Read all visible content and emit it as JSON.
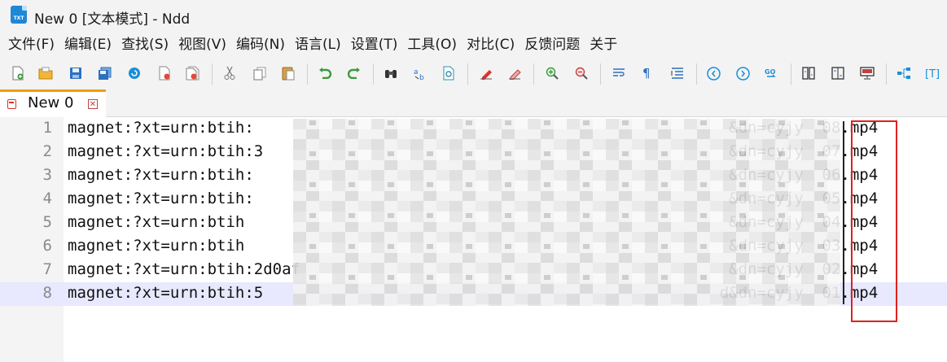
{
  "window": {
    "app_icon_text": "TXT",
    "title": "New 0 [文本模式] - Ndd"
  },
  "menu": [
    "文件(F)",
    "编辑(E)",
    "查找(S)",
    "视图(V)",
    "编码(N)",
    "语言(L)",
    "设置(T)",
    "工具(O)",
    "对比(C)",
    "反馈问题",
    "关于"
  ],
  "toolbar_icons": [
    "new-file-icon",
    "open-file-icon",
    "save-icon",
    "save-all-icon",
    "reload-icon",
    "close-icon",
    "close-all-icon",
    "cut-icon",
    "copy-icon",
    "paste-icon",
    "undo-icon",
    "redo-icon",
    "find-icon",
    "replace-icon",
    "find-in-files-icon",
    "mark-icon",
    "clear-mark-icon",
    "zoom-in-icon",
    "zoom-out-icon",
    "wrap-icon",
    "show-symbols-icon",
    "indent-guide-icon",
    "prev-icon",
    "next-icon",
    "goto-icon",
    "compare-file-icon",
    "compare-dir-icon",
    "compare-bin-icon",
    "structure-icon",
    "text-mode-icon"
  ],
  "tab": {
    "label": "New 0",
    "close_glyph": "✕"
  },
  "editor": {
    "lines": [
      {
        "num": "1",
        "text": "magnet:?xt=urn:btih:                                                   &dn=cyjy  08.mp4"
      },
      {
        "num": "2",
        "text": "magnet:?xt=urn:btih:3                                                  &dn=cyjy  07.mp4"
      },
      {
        "num": "3",
        "text": "magnet:?xt=urn:btih:                                                   &dn=cyjy  06.mp4"
      },
      {
        "num": "4",
        "text": "magnet:?xt=urn:btih:                                                   &dn=cyjy  05.mp4"
      },
      {
        "num": "5",
        "text": "magnet:?xt=urn:btih                                                    &dn=cyjy  04.mp4"
      },
      {
        "num": "6",
        "text": "magnet:?xt=urn:btih                                                    &dn=cyjy  03.mp4"
      },
      {
        "num": "7",
        "text": "magnet:?xt=urn:btih:2d0af                                              &dn=cyjy  02.mp4"
      },
      {
        "num": "8",
        "text": "magnet:?xt=urn:btih:5                                                 d&dn=cyjy  01.mp4"
      }
    ]
  },
  "colors": {
    "tab_accent": "#f0a000",
    "highlight_box": "#e02020",
    "current_line": "#e8e8ff"
  }
}
